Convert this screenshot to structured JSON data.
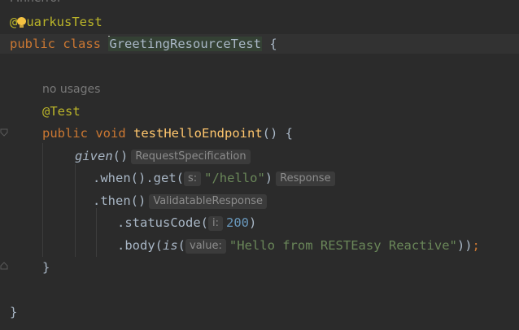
{
  "header_hint": "FInnerror",
  "line_annotation": {
    "at": "@",
    "name_tail": "uarkusTest"
  },
  "line_class": {
    "kw_public": "public",
    "kw_class": "class",
    "class_name": "GreetingResourceTest",
    "brace": " {"
  },
  "usages_hint": "no usages",
  "test_annotation": "@Test",
  "method_decl": {
    "kw_public": "public",
    "kw_void": "void",
    "name": "testHelloEndpoint",
    "rest": "() {"
  },
  "given_line": {
    "call": "given",
    "parens": "()",
    "type_hint": "RequestSpecification"
  },
  "when_line": {
    "code": ".when().get(",
    "param_hint": "s:",
    "arg": "\"/hello\"",
    "close": ")",
    "type_hint": "Response"
  },
  "then_line": {
    "code": ".then()",
    "type_hint": "ValidatableResponse"
  },
  "status_line": {
    "code": ".statusCode(",
    "param_hint": "i:",
    "arg": "200",
    "close": ")"
  },
  "body_line": {
    "code": ".body(",
    "is_call": "is",
    "open": "(",
    "param_hint": "value:",
    "arg": "\"Hello from RESTEasy Reactive\"",
    "close": "))",
    "semi": ";"
  },
  "method_close": "}",
  "class_close": "}",
  "colors": {
    "background": "#2b2b2b",
    "keyword": "#cc7832",
    "annotation": "#bbb529",
    "method": "#ffc66d",
    "string": "#6a8759",
    "number": "#6897bb",
    "text": "#a9b7c6"
  }
}
